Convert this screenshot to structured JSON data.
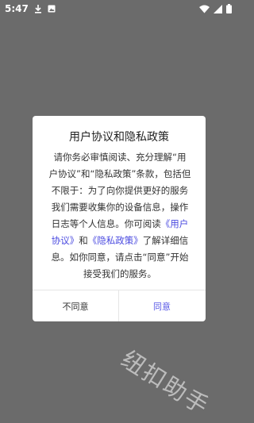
{
  "status_bar": {
    "time": "5:47",
    "left_icons": [
      "download-icon",
      "image-icon"
    ],
    "right_icons": [
      "wifi-icon",
      "signal-icon",
      "battery-icon"
    ]
  },
  "dialog": {
    "title": "用户协议和隐私政策",
    "body_lines": [
      "请你务必审慎阅读、充分理解“用",
      "户协议”和“隐私政策”条款，包括但",
      "不限于：为了向你提供更好的服务",
      "我们需要收集你的设备信息，操作",
      "日志等个人信息。你可阅读"
    ],
    "link_user_agreement_part1": "《用户",
    "link_user_agreement_part2": "协议》",
    "and_text": "和",
    "link_privacy_policy": "《隐私政策》",
    "after_link_text": "了解详细信",
    "line7": "息。如你同意，请点击“同意”开始",
    "line8": "接受我们的服务。",
    "disagree_label": "不同意",
    "agree_label": "同意"
  },
  "watermark": "纽扣助手",
  "colors": {
    "background": "#6b6b6b",
    "link": "#4a4ae0",
    "agree": "#5a5ae6"
  }
}
